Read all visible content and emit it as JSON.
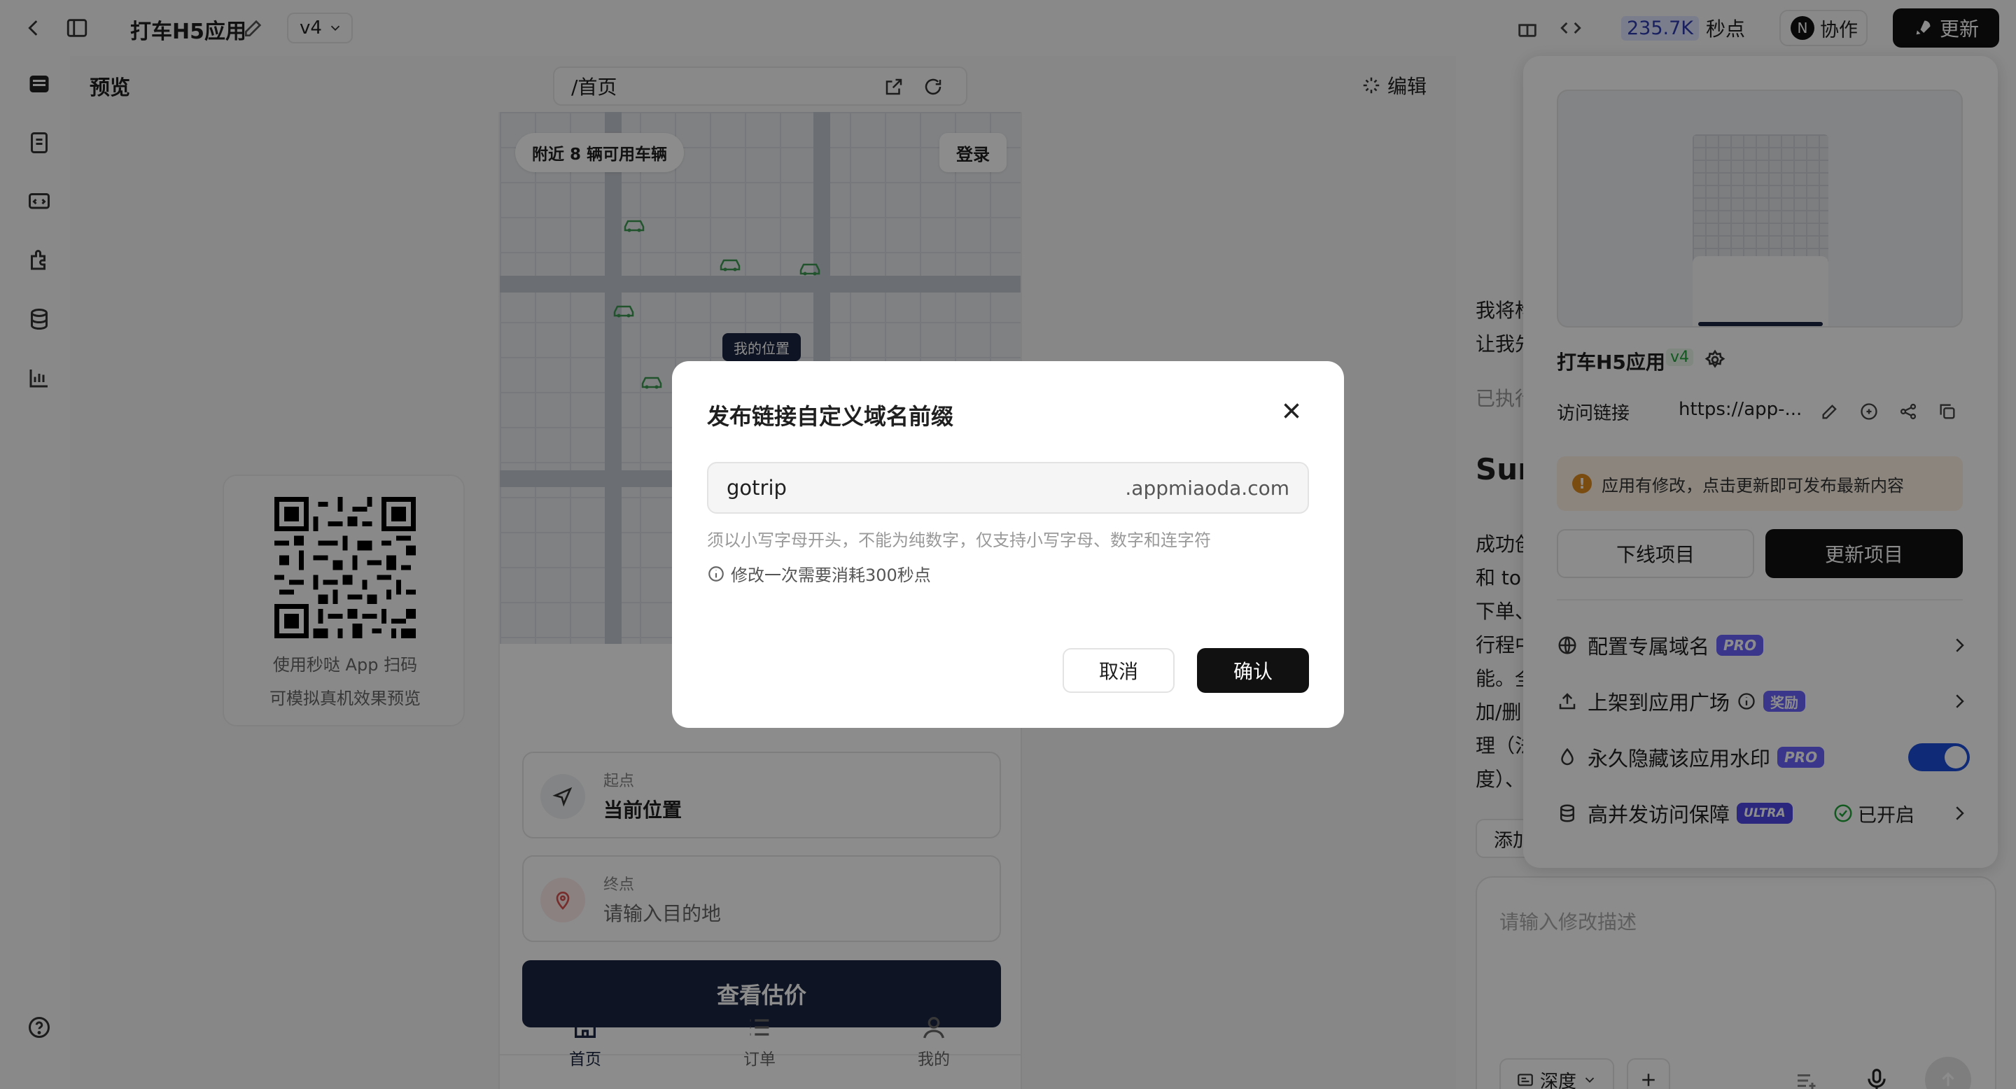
{
  "topbar": {
    "app_title": "打车H5应用",
    "version": "v4",
    "points_value": "235.7K",
    "points_label": "秒点",
    "collab_avatar": "N",
    "collab_label": "协作",
    "update_label": "更新"
  },
  "preview": {
    "title": "预览",
    "url_path": "/首页",
    "edit_label": "编辑",
    "qr_caption_1": "使用秒哒 App 扫码",
    "qr_caption_2": "可模拟真机效果预览"
  },
  "phone": {
    "nearby_badge": "附近 8 辆可用车辆",
    "login_label": "登录",
    "my_location_label": "我的位置",
    "start_label": "起点",
    "start_value": "当前位置",
    "end_label": "终点",
    "end_placeholder": "请输入目的地",
    "estimate_button": "查看估价",
    "tabs": [
      {
        "label": "首页",
        "icon": "home-icon",
        "active": true
      },
      {
        "label": "订单",
        "icon": "list-icon",
        "active": false
      },
      {
        "label": "我的",
        "icon": "user-icon",
        "active": false
      }
    ]
  },
  "chat": {
    "snippet_1": "我将构",
    "snippet_2": "让我先",
    "snippet_3": "已执行",
    "heading": "Sun",
    "lines": [
      "成功创",
      "和 to",
      "下单、",
      "行程中",
      "能。全",
      "加/删",
      "理（法",
      "度）、"
    ],
    "add_chip": "添加",
    "input_placeholder": "请输入修改描述",
    "depth_label": "深度"
  },
  "publish_panel": {
    "app_name": "打车H5应用",
    "version": "v4",
    "link_label": "访问链接",
    "link_value": "https://app-...",
    "notice": "应用有修改，点击更新即可发布最新内容",
    "offline_button": "下线项目",
    "update_button": "更新项目",
    "rows": [
      {
        "label": "配置专属域名",
        "badge": "PRO",
        "badge_color": "#6b63ff"
      },
      {
        "label": "上架到应用广场",
        "badge": "奖励",
        "badge_color": "#6b63ff"
      },
      {
        "label": "永久隐藏该应用水印",
        "badge": "PRO",
        "badge_color": "#6b63ff"
      },
      {
        "label": "高并发访问保障",
        "badge": "ULTRA",
        "badge_color": "#4f46e5",
        "status": "已开启"
      }
    ]
  },
  "modal": {
    "title": "发布链接自定义域名前缀",
    "input_value": "gotrip",
    "domain_suffix": ".appmiaoda.com",
    "hint": "须以小写字母开头，不能为纯数字，仅支持小写字母、数字和连字符",
    "cost_note": "修改一次需要消耗300秒点",
    "cancel_label": "取消",
    "confirm_label": "确认"
  },
  "colors": {
    "accent": "#1d4ed8",
    "dark_button": "#1b2541",
    "pro_purple": "#6b63ff",
    "success_green": "#22a33a",
    "warning_orange": "#e08a1e"
  }
}
